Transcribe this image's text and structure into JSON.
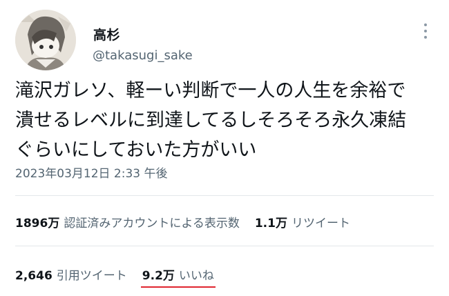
{
  "tweet": {
    "display_name": "高杉",
    "handle": "@takasugi_sake",
    "text": "滝沢ガレソ、軽ーい判断で一人の人生を余裕で\n潰せるレベルに到達してるしそろそろ永久凍結\nぐらいにしておいた方がいい",
    "timestamp": "2023年03月12日 2:33 午後"
  },
  "stats": {
    "views_count": "1896万",
    "views_label": "認証済みアカウントによる表示数",
    "retweets_count": "1.1万",
    "retweets_label": "リツイート",
    "quotes_count": "2,646",
    "quotes_label": "引用ツイート",
    "likes_count": "9.2万",
    "likes_label": "いいね"
  },
  "colors": {
    "secondary_text": "#536471",
    "highlight_underline": "#e0242f"
  },
  "icons": {
    "more": "more-options-icon",
    "avatar": "avatar"
  }
}
